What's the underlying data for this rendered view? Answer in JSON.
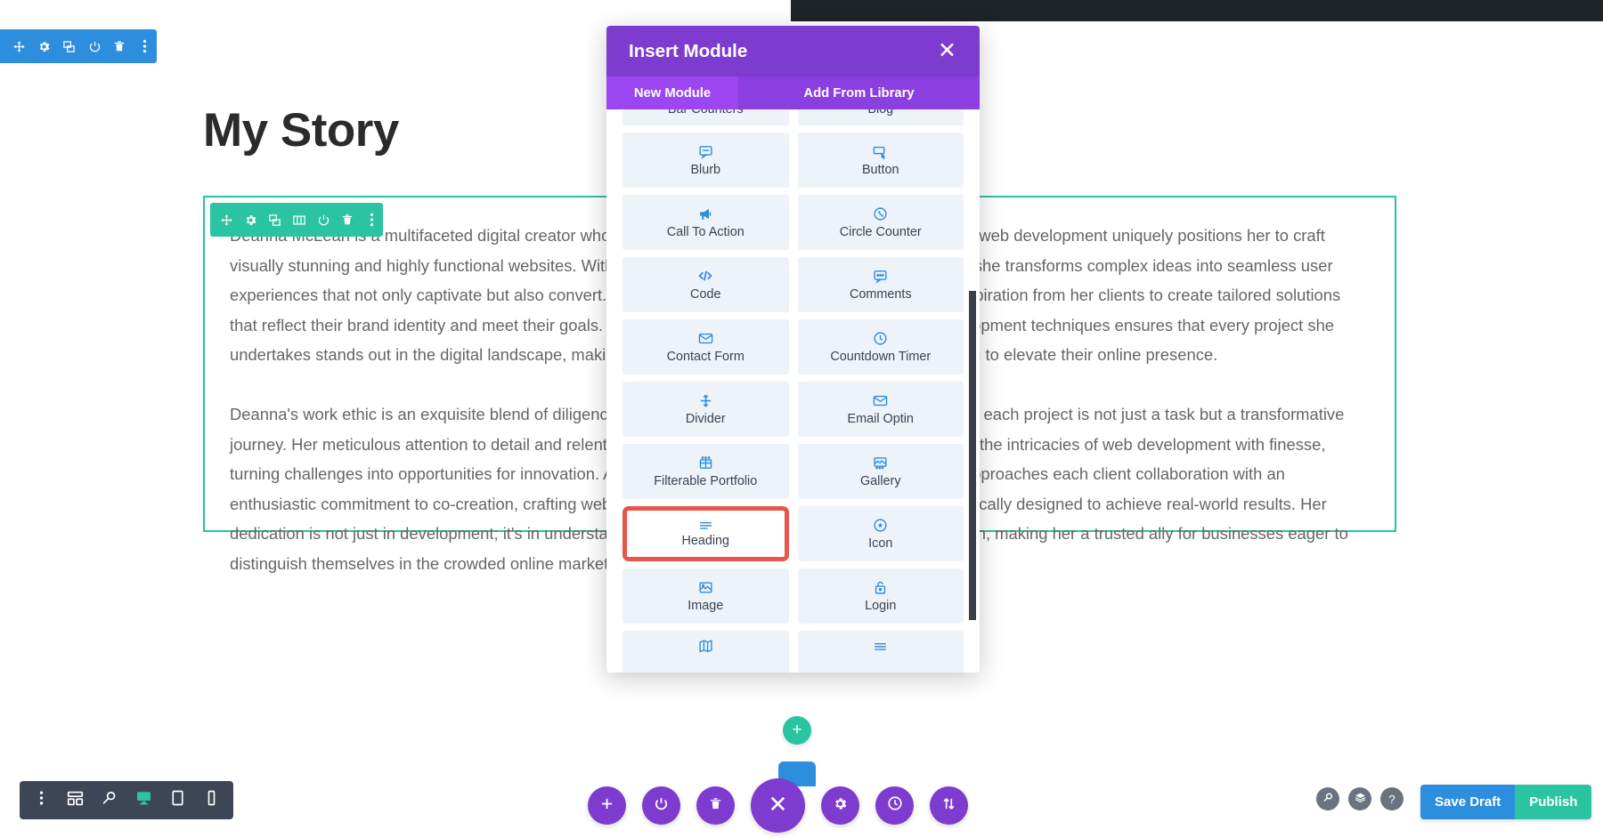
{
  "page": {
    "title": "My Story",
    "body_text": "Deanna McLean is a multifaceted digital creator whose background in graphic design, web design, and web development uniquely positions her to craft visually stunning and highly functional websites. With an innate ability to blend artistry with technology, she transforms complex ideas into seamless user experiences that not only captivate but also convert. Deanna thrives on collaboration, often drawing inspiration from her clients to create tailored solutions that reflect their brand identity and meet their goals. Her expertise in the latest design trends and development techniques ensures that every project she undertakes stands out in the digital landscape, making her a sought-after partner for businesses looking to elevate their online presence.\n\nDeanna's work ethic is an exquisite blend of diligence, creativity, and unwavering passion, ensuring that each project is not just a task but a transformative journey. Her meticulous attention to detail and relentless pursuit of excellence empower her to navigate the intricacies of web development with finesse, turning challenges into opportunities for innovation. Always staying ahead of industry trends, Deanna approaches each client collaboration with an enthusiastic commitment to co-creation, crafting websites that not only resonate visually but are strategically designed to achieve real-world results. Her dedication is not just in development; it's in understanding the unique story of each brand she works with, making her a trusted ally for businesses eager to distinguish themselves in the crowded online marketplace."
  },
  "section_toolbar": {
    "buttons": [
      {
        "name": "move-section",
        "icon": "move-icon"
      },
      {
        "name": "section-settings",
        "icon": "gear-icon"
      },
      {
        "name": "duplicate-section",
        "icon": "duplicate-icon"
      },
      {
        "name": "disable-section",
        "icon": "power-icon"
      },
      {
        "name": "delete-section",
        "icon": "trash-icon"
      },
      {
        "name": "section-more",
        "icon": "dots-vertical-icon"
      }
    ]
  },
  "row_toolbar": {
    "buttons": [
      {
        "name": "move-row",
        "icon": "move-icon"
      },
      {
        "name": "row-settings",
        "icon": "gear-icon"
      },
      {
        "name": "duplicate-row",
        "icon": "duplicate-icon"
      },
      {
        "name": "row-columns",
        "icon": "columns-icon"
      },
      {
        "name": "disable-row",
        "icon": "power-icon"
      },
      {
        "name": "delete-row",
        "icon": "trash-icon"
      },
      {
        "name": "row-more",
        "icon": "dots-vertical-icon"
      }
    ]
  },
  "modal": {
    "title": "Insert Module",
    "close_label": "✕",
    "tabs": [
      {
        "label": "New Module",
        "active": true
      },
      {
        "label": "Add From Library",
        "active": false
      }
    ],
    "modules": [
      {
        "label": "Bar Counters",
        "icon": "bar-counters-icon",
        "partial": true
      },
      {
        "label": "Blog",
        "icon": "blog-icon",
        "partial": true
      },
      {
        "label": "Blurb",
        "icon": "blurb-icon"
      },
      {
        "label": "Button",
        "icon": "button-icon"
      },
      {
        "label": "Call To Action",
        "icon": "megaphone-icon"
      },
      {
        "label": "Circle Counter",
        "icon": "circle-counter-icon"
      },
      {
        "label": "Code",
        "icon": "code-icon"
      },
      {
        "label": "Comments",
        "icon": "comments-icon"
      },
      {
        "label": "Contact Form",
        "icon": "envelope-icon"
      },
      {
        "label": "Countdown Timer",
        "icon": "clock-icon"
      },
      {
        "label": "Divider",
        "icon": "divider-icon"
      },
      {
        "label": "Email Optin",
        "icon": "envelope-icon"
      },
      {
        "label": "Filterable Portfolio",
        "icon": "grid-icon"
      },
      {
        "label": "Gallery",
        "icon": "gallery-icon"
      },
      {
        "label": "Heading",
        "icon": "heading-lines-icon",
        "highlighted": true
      },
      {
        "label": "Icon",
        "icon": "star-circle-icon"
      },
      {
        "label": "Image",
        "icon": "image-icon"
      },
      {
        "label": "Login",
        "icon": "lock-icon"
      },
      {
        "label": "",
        "icon": "map-icon",
        "partial": true
      },
      {
        "label": "",
        "icon": "menu-lines-icon",
        "partial": true
      }
    ]
  },
  "add_section": {
    "label": "+"
  },
  "device_toolbar": {
    "buttons": [
      {
        "name": "view-more",
        "icon": "dots-vertical-icon",
        "active": false
      },
      {
        "name": "wireframe-view",
        "icon": "wireframe-icon",
        "active": false
      },
      {
        "name": "zoom-view",
        "icon": "magnifier-icon",
        "active": false
      },
      {
        "name": "desktop-view",
        "icon": "desktop-icon",
        "active": true
      },
      {
        "name": "tablet-view",
        "icon": "tablet-icon",
        "active": false
      },
      {
        "name": "phone-view",
        "icon": "phone-icon",
        "active": false
      }
    ]
  },
  "main_toolbar": {
    "buttons": [
      {
        "name": "add-module",
        "icon": "plus-icon",
        "big": false
      },
      {
        "name": "toggle-wireframe",
        "icon": "power-icon",
        "big": false
      },
      {
        "name": "trash",
        "icon": "trash-icon",
        "big": false
      },
      {
        "name": "close-menu",
        "icon": "close-x-icon",
        "big": true
      },
      {
        "name": "settings",
        "icon": "gear-icon",
        "big": false
      },
      {
        "name": "history",
        "icon": "clock-icon",
        "big": false
      },
      {
        "name": "portability",
        "icon": "arrows-updown-icon",
        "big": false
      }
    ]
  },
  "helper_icons": [
    {
      "name": "search-helper",
      "icon": "magnifier-icon",
      "glyph": "⚲"
    },
    {
      "name": "layers-helper",
      "icon": "layers-icon",
      "glyph": "≣"
    },
    {
      "name": "help-helper",
      "icon": "question-icon",
      "glyph": "?"
    }
  ],
  "actions": {
    "save_draft": "Save Draft",
    "publish": "Publish"
  },
  "colors": {
    "section_blue": "#2e8ede",
    "row_green": "#2ac4a2",
    "modal_purple": "#7e3bd0",
    "tab_purple": "#9b46f0",
    "highlight_red": "#e8554e",
    "publish_green": "#2ac4a2"
  }
}
